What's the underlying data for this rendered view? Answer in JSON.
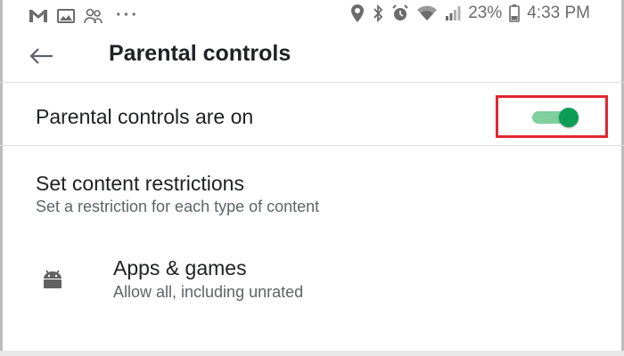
{
  "status_bar": {
    "time": "4:33 PM",
    "battery": "23%",
    "left_icons": [
      "gmail-icon",
      "photo-icon",
      "people-icon",
      "more-dots-icon"
    ],
    "right_icons": [
      "location-icon",
      "bluetooth-icon",
      "alarm-icon",
      "wifi-icon",
      "signal-icon",
      "battery-icon"
    ],
    "more": "···"
  },
  "app_bar": {
    "title": "Parental controls",
    "back_icon": "arrow-left-icon"
  },
  "toggle": {
    "label": "Parental controls are on",
    "on": true,
    "track_color": "#7fcf9f",
    "thumb_color": "#0d9d55",
    "highlight_color": "#e3262f"
  },
  "content_restrictions": {
    "title": "Set content restrictions",
    "subtitle": "Set a restriction for each type of content"
  },
  "items": [
    {
      "title": "Apps & games",
      "subtitle": "Allow all, including unrated",
      "icon": "android-icon"
    }
  ]
}
